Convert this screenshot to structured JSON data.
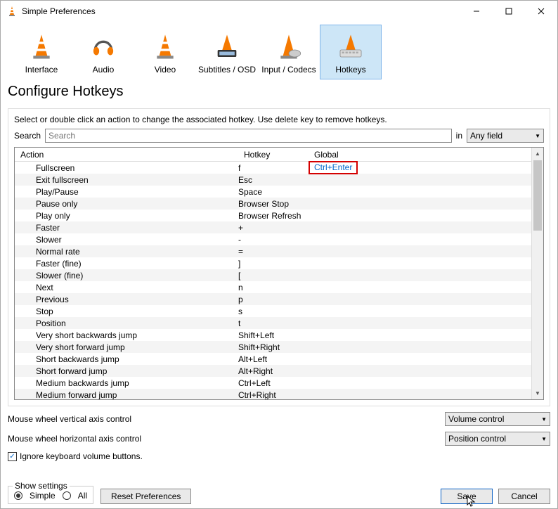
{
  "window": {
    "title": "Simple Preferences"
  },
  "tabs": [
    {
      "label": "Interface"
    },
    {
      "label": "Audio"
    },
    {
      "label": "Video"
    },
    {
      "label": "Subtitles / OSD"
    },
    {
      "label": "Input / Codecs"
    },
    {
      "label": "Hotkeys"
    }
  ],
  "heading": "Configure Hotkeys",
  "instructions": "Select or double click an action to change the associated hotkey. Use delete key to remove hotkeys.",
  "search": {
    "label": "Search",
    "placeholder": "Search",
    "in_label": "in",
    "field": "Any field"
  },
  "columns": {
    "action": "Action",
    "hotkey": "Hotkey",
    "global": "Global"
  },
  "rows": [
    {
      "action": "Fullscreen",
      "hotkey": "f",
      "global": "Ctrl+Enter",
      "global_hl": true
    },
    {
      "action": "Exit fullscreen",
      "hotkey": "Esc",
      "global": ""
    },
    {
      "action": "Play/Pause",
      "hotkey": "Space",
      "global": ""
    },
    {
      "action": "Pause only",
      "hotkey": "Browser Stop",
      "global": ""
    },
    {
      "action": "Play only",
      "hotkey": "Browser Refresh",
      "global": ""
    },
    {
      "action": "Faster",
      "hotkey": "+",
      "global": ""
    },
    {
      "action": "Slower",
      "hotkey": "-",
      "global": ""
    },
    {
      "action": "Normal rate",
      "hotkey": "=",
      "global": ""
    },
    {
      "action": "Faster (fine)",
      "hotkey": "]",
      "global": ""
    },
    {
      "action": "Slower (fine)",
      "hotkey": "[",
      "global": ""
    },
    {
      "action": "Next",
      "hotkey": "n",
      "global": ""
    },
    {
      "action": "Previous",
      "hotkey": "p",
      "global": ""
    },
    {
      "action": "Stop",
      "hotkey": "s",
      "global": ""
    },
    {
      "action": "Position",
      "hotkey": "t",
      "global": ""
    },
    {
      "action": "Very short backwards jump",
      "hotkey": "Shift+Left",
      "global": ""
    },
    {
      "action": "Very short forward jump",
      "hotkey": "Shift+Right",
      "global": ""
    },
    {
      "action": "Short backwards jump",
      "hotkey": "Alt+Left",
      "global": ""
    },
    {
      "action": "Short forward jump",
      "hotkey": "Alt+Right",
      "global": ""
    },
    {
      "action": "Medium backwards jump",
      "hotkey": "Ctrl+Left",
      "global": ""
    },
    {
      "action": "Medium forward jump",
      "hotkey": "Ctrl+Right",
      "global": ""
    }
  ],
  "mouse": {
    "vertical_label": "Mouse wheel vertical axis control",
    "vertical_value": "Volume control",
    "horizontal_label": "Mouse wheel horizontal axis control",
    "horizontal_value": "Position control",
    "ignore_label": "Ignore keyboard volume buttons.",
    "ignore_checked": true
  },
  "show_settings": {
    "legend": "Show settings",
    "simple": "Simple",
    "all": "All",
    "selected": "simple"
  },
  "buttons": {
    "reset": "Reset Preferences",
    "save": "Save",
    "cancel": "Cancel"
  }
}
